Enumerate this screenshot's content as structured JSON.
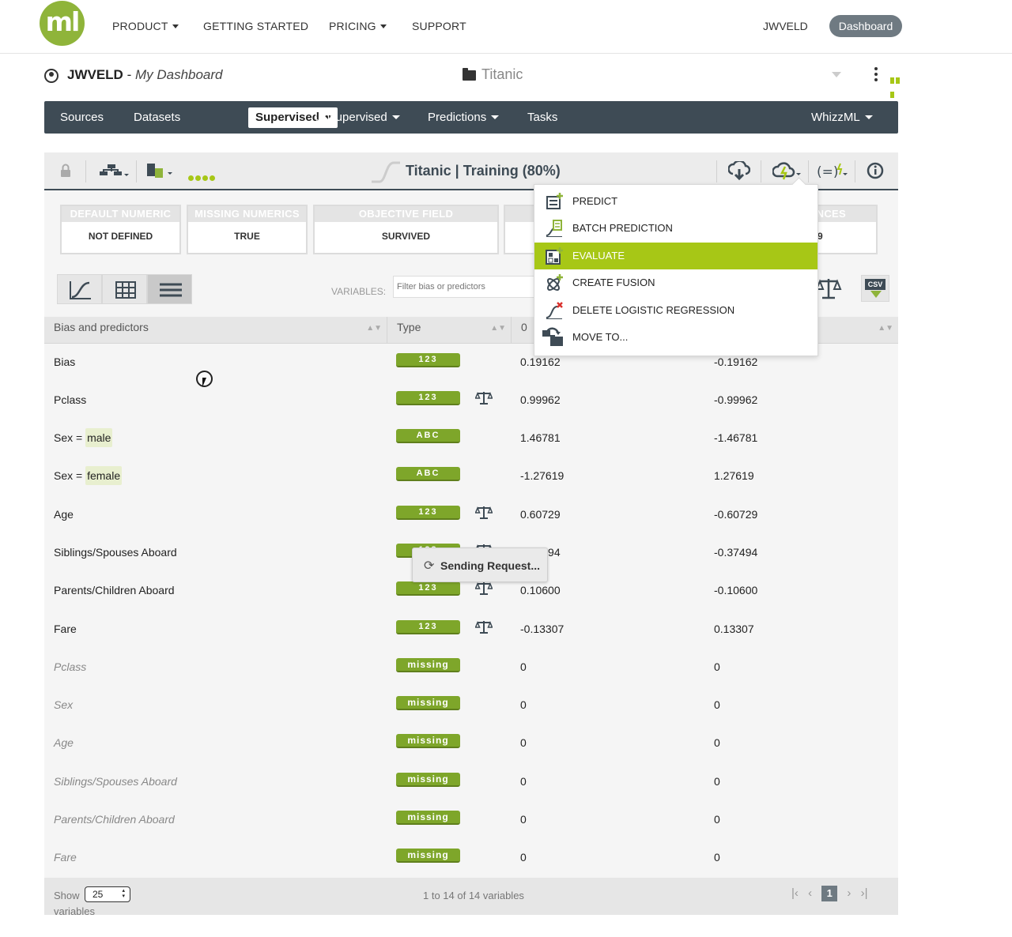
{
  "topnav": {
    "logo_text": "ml",
    "items": [
      {
        "label": "PRODUCT",
        "has_caret": true
      },
      {
        "label": "GETTING STARTED",
        "has_caret": false
      },
      {
        "label": "PRICING",
        "has_caret": true
      },
      {
        "label": "SUPPORT",
        "has_caret": false
      }
    ],
    "user": "JWVELD",
    "dashboard_button": "Dashboard"
  },
  "header": {
    "owner": "JWVELD",
    "separator": " - ",
    "dashboard_name": "My Dashboard",
    "project": "Titanic"
  },
  "mainnav": {
    "items": [
      "Sources",
      "Datasets",
      "Supervised",
      "Unsupervised",
      "Predictions",
      "Tasks",
      "WhizzML"
    ],
    "active": "Supervised"
  },
  "toolbar": {
    "title": "Titanic | Training (80%)"
  },
  "info_boxes": [
    {
      "head": "DEFAULT NUMERIC",
      "value": "NOT DEFINED"
    },
    {
      "head": "MISSING NUMERICS",
      "value": "TRUE"
    },
    {
      "head": "OBJECTIVE FIELD",
      "value": "SURVIVED"
    },
    {
      "head": "NCES",
      "value": "9"
    }
  ],
  "filter": {
    "label": "VARIABLES:",
    "placeholder": "Filter bias or predictors"
  },
  "table": {
    "headers": [
      "Bias and predictors",
      "Type",
      "0"
    ],
    "rows": [
      {
        "name": "Bias",
        "prefix": "",
        "category": "",
        "type": "123",
        "scale": false,
        "v0": "0.19162",
        "v1": "-0.19162",
        "italic": false
      },
      {
        "name": "Pclass",
        "prefix": "",
        "category": "",
        "type": "123",
        "scale": true,
        "v0": "0.99962",
        "v1": "-0.99962",
        "italic": false
      },
      {
        "name": "",
        "prefix": "Sex = ",
        "category": "male",
        "type": "ABC",
        "scale": false,
        "v0": "1.46781",
        "v1": "-1.46781",
        "italic": false
      },
      {
        "name": "",
        "prefix": "Sex = ",
        "category": "female",
        "type": "ABC",
        "scale": false,
        "v0": "-1.27619",
        "v1": "1.27619",
        "italic": false
      },
      {
        "name": "Age",
        "prefix": "",
        "category": "",
        "type": "123",
        "scale": true,
        "v0": "0.60729",
        "v1": "-0.60729",
        "italic": false
      },
      {
        "name": "Siblings/Spouses Aboard",
        "prefix": "",
        "category": "",
        "type": "123",
        "scale": true,
        "v0": "0.37494",
        "v1": "-0.37494",
        "italic": false
      },
      {
        "name": "Parents/Children Aboard",
        "prefix": "",
        "category": "",
        "type": "123",
        "scale": true,
        "v0": "0.10600",
        "v1": "-0.10600",
        "italic": false
      },
      {
        "name": "Fare",
        "prefix": "",
        "category": "",
        "type": "123",
        "scale": true,
        "v0": "-0.13307",
        "v1": "0.13307",
        "italic": false
      },
      {
        "name": "Pclass",
        "prefix": "",
        "category": "",
        "type": "missing",
        "scale": false,
        "v0": "0",
        "v1": "0",
        "italic": true
      },
      {
        "name": "Sex",
        "prefix": "",
        "category": "",
        "type": "missing",
        "scale": false,
        "v0": "0",
        "v1": "0",
        "italic": true
      },
      {
        "name": "Age",
        "prefix": "",
        "category": "",
        "type": "missing",
        "scale": false,
        "v0": "0",
        "v1": "0",
        "italic": true
      },
      {
        "name": "Siblings/Spouses Aboard",
        "prefix": "",
        "category": "",
        "type": "missing",
        "scale": false,
        "v0": "0",
        "v1": "0",
        "italic": true
      },
      {
        "name": "Parents/Children Aboard",
        "prefix": "",
        "category": "",
        "type": "missing",
        "scale": false,
        "v0": "0",
        "v1": "0",
        "italic": true
      },
      {
        "name": "Fare",
        "prefix": "",
        "category": "",
        "type": "missing",
        "scale": false,
        "v0": "0",
        "v1": "0",
        "italic": true
      }
    ]
  },
  "footer": {
    "show_label": "Show",
    "page_size": "25",
    "variables_label": "variables",
    "range": "1 to 14 of 14 variables",
    "current_page": "1"
  },
  "menu": {
    "items": [
      {
        "label": "PREDICT",
        "icon": "predict-icon",
        "highlighted": false
      },
      {
        "label": "BATCH PREDICTION",
        "icon": "batch-prediction-icon",
        "highlighted": false
      },
      {
        "label": "EVALUATE",
        "icon": "evaluate-icon",
        "highlighted": true
      },
      {
        "label": "CREATE FUSION",
        "icon": "fusion-icon",
        "highlighted": false
      },
      {
        "label": "DELETE LOGISTIC REGRESSION",
        "icon": "delete-model-icon",
        "highlighted": false
      },
      {
        "label": "MOVE TO...",
        "icon": "move-to-icon",
        "highlighted": false
      }
    ]
  },
  "toast": {
    "text": "Sending Request..."
  },
  "colors": {
    "accent": "#a7c716",
    "badge": "#7ea62a",
    "nav": "#3e4b55",
    "logo": "#8fb43a"
  }
}
